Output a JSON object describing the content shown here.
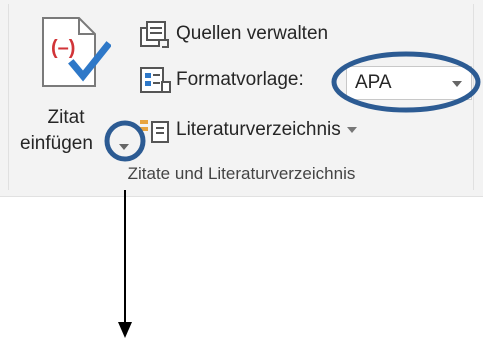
{
  "ribbon": {
    "insert_citation": {
      "line1": "Zitat",
      "line2": "einfügen"
    },
    "manage_sources": "Quellen verwalten",
    "style_label": "Formatvorlage:",
    "style_value": "APA",
    "bibliography": "Literaturverzeichnis",
    "group_label": "Zitate und Literaturverzeichnis"
  },
  "icons": {
    "insert_citation": "citation-document-check-icon",
    "manage_sources": "manage-sources-icon",
    "style": "format-style-icon",
    "bibliography": "bibliography-icon"
  },
  "colors": {
    "check_blue": "#2e78c8",
    "citation_red": "#d13438",
    "annotation_ring": "#2c5b93",
    "ribbon_bg": "#f3f3f3"
  }
}
